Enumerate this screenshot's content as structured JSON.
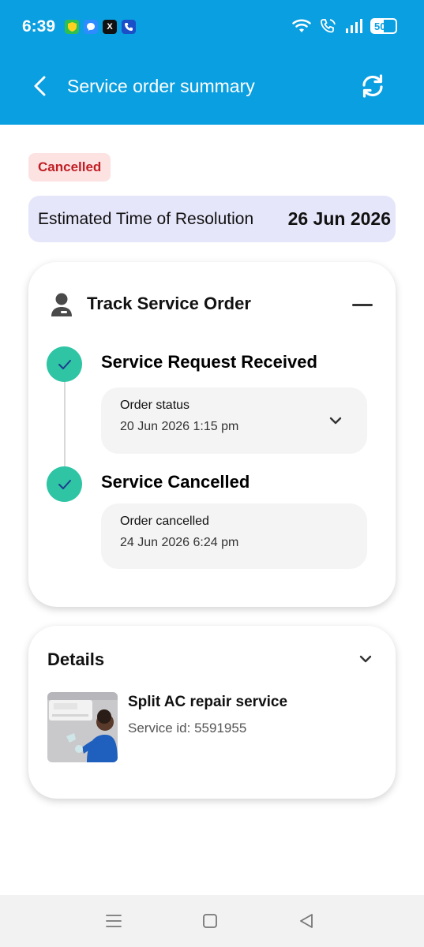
{
  "status_bar": {
    "time": "6:39",
    "apps": [
      {
        "icon": "shield-app-icon",
        "color": "#2fbf4f"
      },
      {
        "icon": "messenger-app-icon",
        "color": "#2d8cff"
      },
      {
        "icon": "x-app-icon",
        "color": "#111111",
        "glyph": "𝕏"
      },
      {
        "icon": "phone-app-icon",
        "color": "#1a4fc7"
      }
    ],
    "battery": "50",
    "battery_level": 0.5
  },
  "app_bar": {
    "title": "Service order summary",
    "back_icon": "back-arrow-icon",
    "refresh_icon": "refresh-icon"
  },
  "status_badge": "Cancelled",
  "resolution": {
    "label": "Estimated Time of Resolution",
    "date": "26 Jun 2026"
  },
  "tracking": {
    "title": "Track Service Order",
    "steps": [
      {
        "title": "Service Request Received",
        "line1": "Order status",
        "line2": "20 Jun 2026 1:15 pm",
        "expandable": true
      },
      {
        "title": "Service Cancelled",
        "line1": "Order cancelled",
        "line2": "24 Jun 2026 6:24 pm",
        "expandable": false
      }
    ]
  },
  "details": {
    "title": "Details",
    "service_name": "Split AC repair service",
    "service_id": "Service id: 5591955"
  },
  "colors": {
    "primary": "#0a9fe0",
    "cancelled_text": "#c01f24",
    "cancelled_bg": "#fde2e2",
    "resolution_bg": "#e6e6fb",
    "check": "#2ec4a4"
  }
}
